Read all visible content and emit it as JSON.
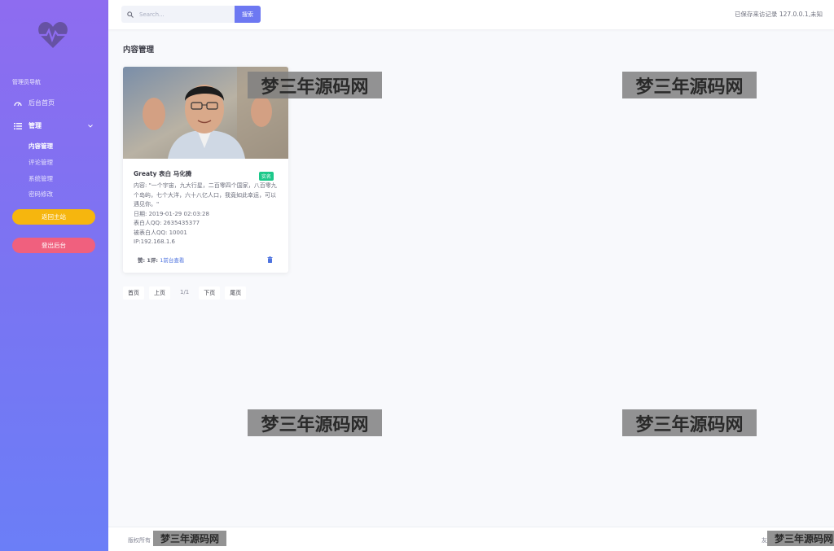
{
  "sidebar": {
    "heading": "管理员导航",
    "items": [
      {
        "label": "后台首页",
        "icon": "dashboard-icon"
      },
      {
        "label": "管理",
        "icon": "list-icon"
      }
    ],
    "sub_items": [
      "内容管理",
      "评论管理",
      "系统管理",
      "密码修改"
    ],
    "home_button": "返回主站",
    "logout_button": "登出后台"
  },
  "topbar": {
    "search_placeholder": "Search...",
    "search_button": "搜索",
    "status": "已保存来访记录 127.0.0.1,未知"
  },
  "main": {
    "page_title": "内容管理",
    "card": {
      "title": "Greaty 表白 马化腾",
      "badge": "实名",
      "content": "内容: \"一个宇宙，九大行星，二百零四个国家，八百零九个岛屿，七个大洋，六十八亿人口，我竟如此幸运，可以遇见你。\"",
      "date": "日期: 2019-01-29 02:03:28",
      "from_qq": "表白人QQ: 2635435377",
      "to_qq": "被表白人QQ: 10001",
      "ip": "IP:192.168.1.6",
      "stats": "赞: 1评: ",
      "link": "1前台查看"
    },
    "pager": {
      "first": "首页",
      "prev": "上页",
      "current": "1/1",
      "next": "下页",
      "last": "尾页"
    }
  },
  "footer": {
    "left": "版权所有",
    "right": "友"
  },
  "watermark": "梦三年源码网",
  "colors": {
    "sidebar_top": "#8e6cf0",
    "sidebar_bottom": "#6b7ef7",
    "primary": "#6d78f2",
    "warning": "#f6b60e",
    "danger": "#f0607e",
    "success": "#1cc88a"
  }
}
